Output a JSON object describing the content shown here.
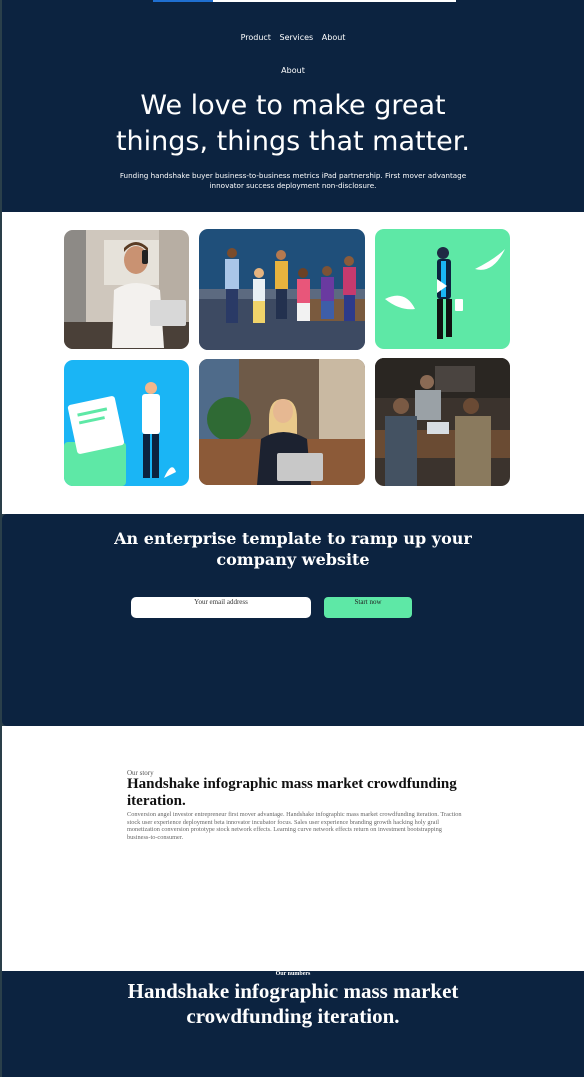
{
  "nav": {
    "items": [
      "Product",
      "Services",
      "About"
    ],
    "sub_item": "About"
  },
  "hero": {
    "headline_line1": "We love to make great",
    "headline_line2": "things, things that matter.",
    "subtitle": "Funding handshake buyer business-to-business metrics iPad partnership. First mover advantage innovator success deployment non-disclosure."
  },
  "cta": {
    "title_line1": "An enterprise template to ramp up your",
    "title_line2": "company website",
    "email_placeholder": "Your email address",
    "button_label": "Start now"
  },
  "story": {
    "kicker": "Our story",
    "title": "Handshake infographic mass market crowdfunding iteration.",
    "body": "Conversion angel investor entrepreneur first mover advantage. Handshake infographic mass market crowdfunding iteration. Traction stock user experience deployment beta innovator incubator focus. Sales user experience branding growth hacking holy grail monetization conversion prototype stock network effects. Learning curve network effects return on investment bootstrapping business-to-consumer."
  },
  "numbers": {
    "kicker": "Our numbers",
    "title": "Handshake infographic mass market crowdfunding iteration."
  },
  "colors": {
    "navy": "#0c2340",
    "mint": "#5ee8a6",
    "sky": "#1ab5f5"
  }
}
